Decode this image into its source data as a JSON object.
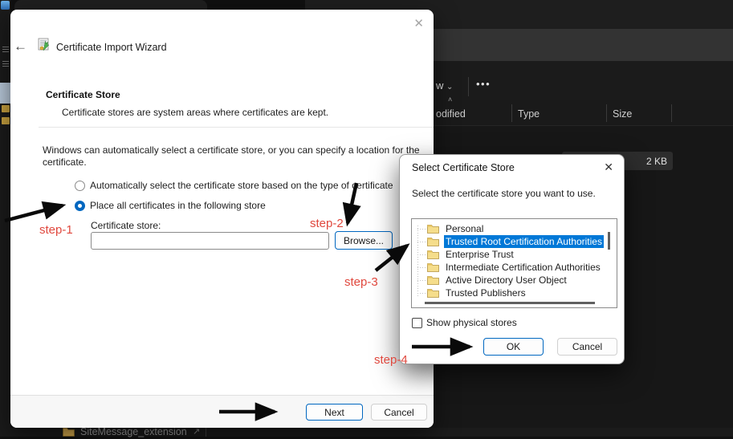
{
  "icons": {
    "back": "←",
    "close": "✕",
    "chevron_down": "⌄",
    "sort_asc": "˄",
    "pin": "↗",
    "more": "•••"
  },
  "wizard": {
    "title": "Certificate Import Wizard",
    "heading": "Certificate Store",
    "subheading": "Certificate stores are system areas where certificates are kept.",
    "description": "Windows can automatically select a certificate store, or you can specify a location for the certificate.",
    "radio_auto_label": "Automatically select the certificate store based on the type of certificate",
    "radio_place_label": "Place all certificates in the following store",
    "store_field_label": "Certificate store:",
    "store_field_value": "",
    "browse_button": "Browse...",
    "next_button": "Next",
    "cancel_button": "Cancel"
  },
  "store_dialog": {
    "title": "Select Certificate Store",
    "prompt": "Select the certificate store you want to use.",
    "stores": [
      {
        "label": "Personal",
        "selected": false
      },
      {
        "label": "Trusted Root Certification Authorities",
        "selected": true
      },
      {
        "label": "Enterprise Trust",
        "selected": false
      },
      {
        "label": "Intermediate Certification Authorities",
        "selected": false
      },
      {
        "label": "Active Directory User Object",
        "selected": false
      },
      {
        "label": "Trusted Publishers",
        "selected": false
      }
    ],
    "show_physical_label": "Show physical stores",
    "ok_button": "OK",
    "cancel_button": "Cancel"
  },
  "explorer": {
    "view_menu_visible": "w",
    "columns": [
      "odified",
      "Type",
      "Size"
    ],
    "selected_file_size": "2 KB",
    "pinned_folder_label": "SiteMessage_extension"
  },
  "annotations": {
    "color": "#e0483e",
    "step1": "step-1",
    "step2": "step-2",
    "step3": "step-3",
    "step4": "step-4"
  }
}
